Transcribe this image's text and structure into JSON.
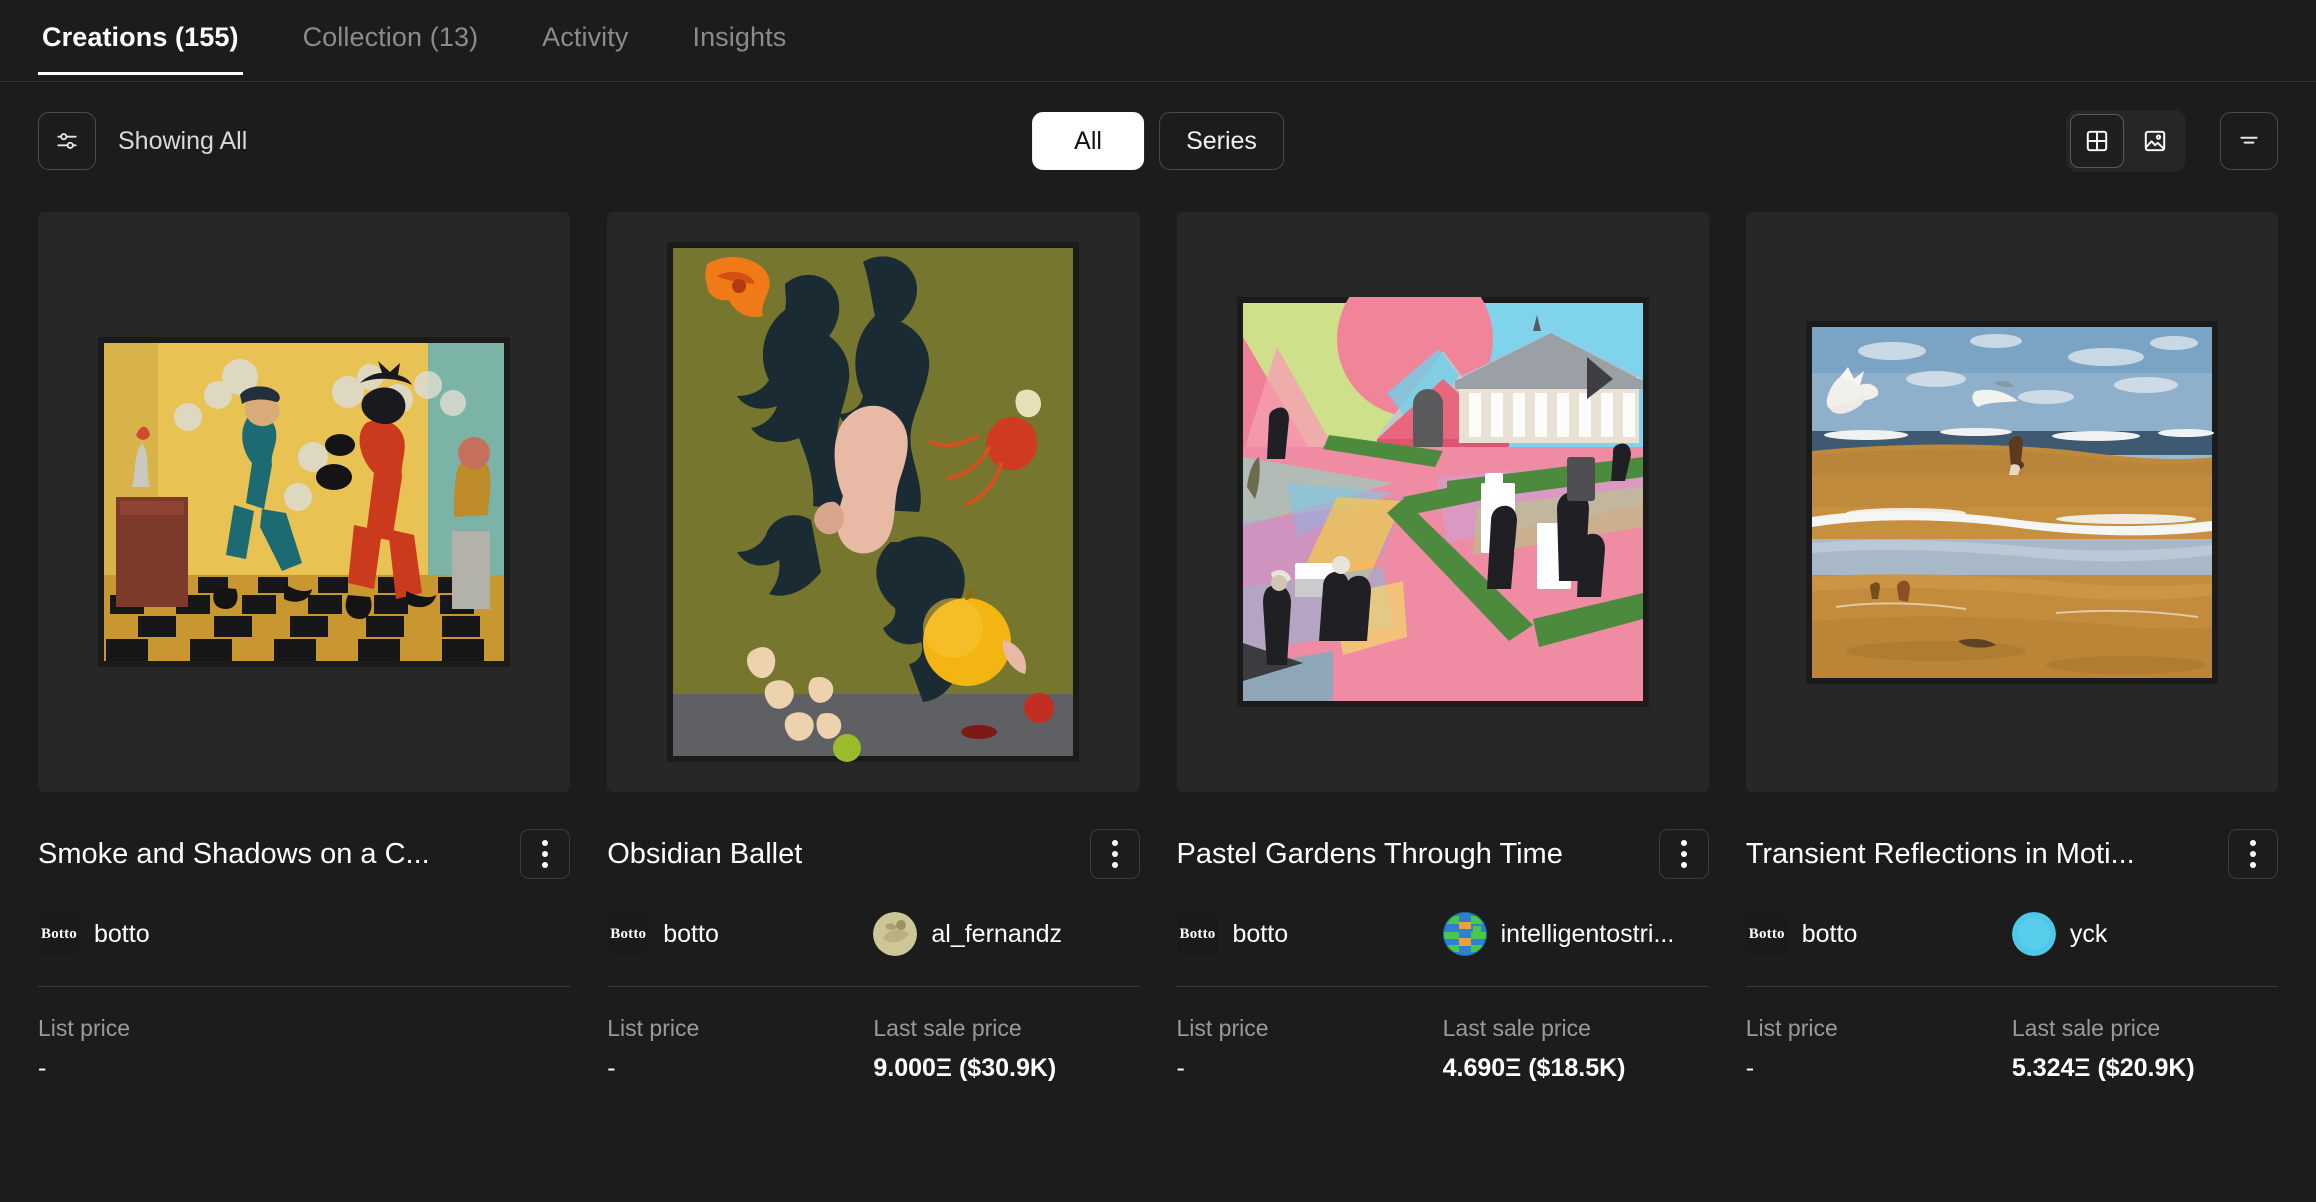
{
  "tabs": [
    {
      "label": "Creations (155)",
      "active": true
    },
    {
      "label": "Collection (13)",
      "active": false
    },
    {
      "label": "Activity",
      "active": false
    },
    {
      "label": "Insights",
      "active": false
    }
  ],
  "toolbar": {
    "filter_icon": "sliders-icon",
    "showing_label": "Showing All",
    "segments": [
      {
        "label": "All",
        "active": true
      },
      {
        "label": "Series",
        "active": false
      }
    ],
    "view_grid_icon": "grid-view-icon",
    "view_image_icon": "image-view-icon",
    "sort_icon": "filter-sort-icon"
  },
  "labels": {
    "list_price": "List price",
    "last_sale_price": "Last sale price",
    "empty_value": "-"
  },
  "cards": [
    {
      "title": "Smoke and Shadows on a C...",
      "creator": "botto",
      "creator_badge": "Botto",
      "owner": null,
      "owner_avatar_color": null,
      "list_price": "-",
      "last_sale_price": null,
      "art": "two-figures-checkered-floor"
    },
    {
      "title": "Obsidian Ballet",
      "creator": "botto",
      "creator_badge": "Botto",
      "owner": "al_fernandz",
      "owner_avatar_color": "#d8cfa4",
      "list_price": "-",
      "last_sale_price": "9.000Ξ ($30.9K)",
      "art": "obsidian-figures-olive"
    },
    {
      "title": "Pastel Gardens Through Time",
      "creator": "botto",
      "creator_badge": "Botto",
      "owner": "intelligentostri...",
      "owner_avatar_color": "#2a9d4f",
      "list_price": "-",
      "last_sale_price": "4.690Ξ ($18.5K)",
      "art": "pastel-geometric-garden"
    },
    {
      "title": "Transient Reflections in Moti...",
      "creator": "botto",
      "creator_badge": "Botto",
      "owner": "yck",
      "owner_avatar_color": "#4ec8e8",
      "list_price": "-",
      "last_sale_price": "5.324Ξ ($20.9K)",
      "art": "beach-seascape"
    }
  ],
  "colors": {
    "page_bg": "#1c1c1c",
    "thumb_bg": "#272727",
    "accent_active": "#ffffff",
    "muted_text": "#9a9a9a"
  }
}
